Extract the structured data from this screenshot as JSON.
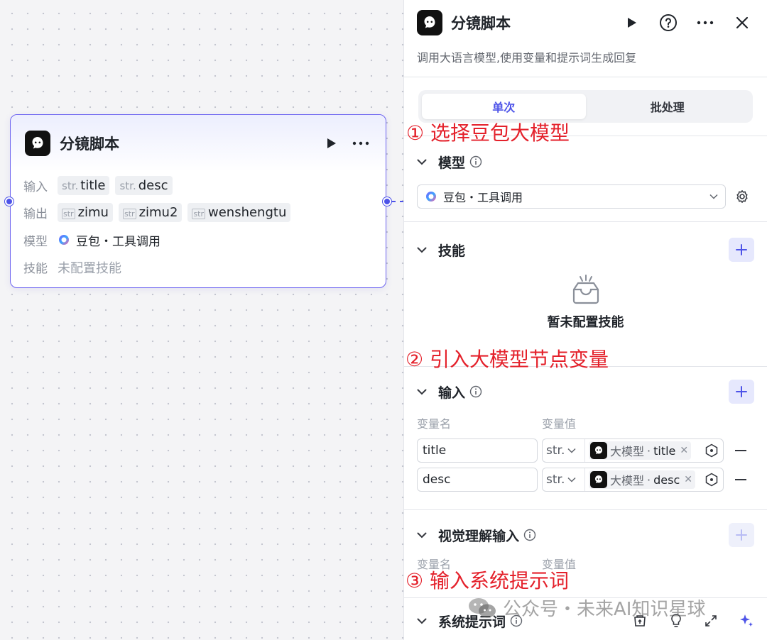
{
  "node": {
    "title": "分镜脚本",
    "run_icon": "play-icon",
    "more_icon": "more-horizontal-icon",
    "rows": {
      "input_label": "输入",
      "output_label": "输出",
      "model_label": "模型",
      "skill_label": "技能"
    },
    "inputs": [
      {
        "type": "str.",
        "name": "title"
      },
      {
        "type": "str.",
        "name": "desc"
      }
    ],
    "outputs": [
      {
        "type": "str",
        "name": "zimu"
      },
      {
        "type": "str",
        "name": "zimu2"
      },
      {
        "type": "str",
        "name": "wenshengtu"
      }
    ],
    "model_value": "豆包・工具调用",
    "skill_value": "未配置技能"
  },
  "panel": {
    "title": "分镜脚本",
    "description": "调用大语言模型,使用变量和提示词生成回复",
    "tabs": [
      "单次",
      "批处理"
    ],
    "active_tab": "单次",
    "model_section": {
      "title": "模型",
      "selected": "豆包・工具调用"
    },
    "skills_section": {
      "title": "技能",
      "empty_text": "暂未配置技能"
    },
    "input_section": {
      "title": "输入",
      "col_name": "变量名",
      "col_value": "变量值",
      "rows": [
        {
          "name": "title",
          "type": "str.",
          "ref_node": "大模型",
          "ref_var": "title"
        },
        {
          "name": "desc",
          "type": "str.",
          "ref_node": "大模型",
          "ref_var": "desc"
        }
      ]
    },
    "vision_section": {
      "title": "视觉理解输入",
      "col_name": "变量名",
      "col_value": "变量值"
    },
    "system_prompt_section": {
      "title": "系统提示词"
    }
  },
  "annotations": {
    "step1": "① 选择豆包大模型",
    "step2": "② 引入大模型节点变量",
    "step3": "③ 输入系统提示词"
  },
  "watermark": "公众号・未来AI知识星球",
  "colors": {
    "accent": "#4d53e8",
    "annotation_red": "#e4212b",
    "node_border": "#6c63f0"
  }
}
